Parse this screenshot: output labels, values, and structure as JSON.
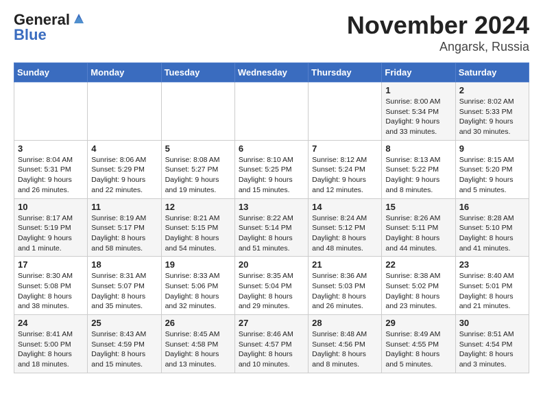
{
  "header": {
    "logo_line1": "General",
    "logo_line2": "Blue",
    "title": "November 2024",
    "subtitle": "Angarsk, Russia"
  },
  "weekdays": [
    "Sunday",
    "Monday",
    "Tuesday",
    "Wednesday",
    "Thursday",
    "Friday",
    "Saturday"
  ],
  "weeks": [
    [
      {
        "day": "",
        "info": ""
      },
      {
        "day": "",
        "info": ""
      },
      {
        "day": "",
        "info": ""
      },
      {
        "day": "",
        "info": ""
      },
      {
        "day": "",
        "info": ""
      },
      {
        "day": "1",
        "info": "Sunrise: 8:00 AM\nSunset: 5:34 PM\nDaylight: 9 hours and 33 minutes."
      },
      {
        "day": "2",
        "info": "Sunrise: 8:02 AM\nSunset: 5:33 PM\nDaylight: 9 hours and 30 minutes."
      }
    ],
    [
      {
        "day": "3",
        "info": "Sunrise: 8:04 AM\nSunset: 5:31 PM\nDaylight: 9 hours and 26 minutes."
      },
      {
        "day": "4",
        "info": "Sunrise: 8:06 AM\nSunset: 5:29 PM\nDaylight: 9 hours and 22 minutes."
      },
      {
        "day": "5",
        "info": "Sunrise: 8:08 AM\nSunset: 5:27 PM\nDaylight: 9 hours and 19 minutes."
      },
      {
        "day": "6",
        "info": "Sunrise: 8:10 AM\nSunset: 5:25 PM\nDaylight: 9 hours and 15 minutes."
      },
      {
        "day": "7",
        "info": "Sunrise: 8:12 AM\nSunset: 5:24 PM\nDaylight: 9 hours and 12 minutes."
      },
      {
        "day": "8",
        "info": "Sunrise: 8:13 AM\nSunset: 5:22 PM\nDaylight: 9 hours and 8 minutes."
      },
      {
        "day": "9",
        "info": "Sunrise: 8:15 AM\nSunset: 5:20 PM\nDaylight: 9 hours and 5 minutes."
      }
    ],
    [
      {
        "day": "10",
        "info": "Sunrise: 8:17 AM\nSunset: 5:19 PM\nDaylight: 9 hours and 1 minute."
      },
      {
        "day": "11",
        "info": "Sunrise: 8:19 AM\nSunset: 5:17 PM\nDaylight: 8 hours and 58 minutes."
      },
      {
        "day": "12",
        "info": "Sunrise: 8:21 AM\nSunset: 5:15 PM\nDaylight: 8 hours and 54 minutes."
      },
      {
        "day": "13",
        "info": "Sunrise: 8:22 AM\nSunset: 5:14 PM\nDaylight: 8 hours and 51 minutes."
      },
      {
        "day": "14",
        "info": "Sunrise: 8:24 AM\nSunset: 5:12 PM\nDaylight: 8 hours and 48 minutes."
      },
      {
        "day": "15",
        "info": "Sunrise: 8:26 AM\nSunset: 5:11 PM\nDaylight: 8 hours and 44 minutes."
      },
      {
        "day": "16",
        "info": "Sunrise: 8:28 AM\nSunset: 5:10 PM\nDaylight: 8 hours and 41 minutes."
      }
    ],
    [
      {
        "day": "17",
        "info": "Sunrise: 8:30 AM\nSunset: 5:08 PM\nDaylight: 8 hours and 38 minutes."
      },
      {
        "day": "18",
        "info": "Sunrise: 8:31 AM\nSunset: 5:07 PM\nDaylight: 8 hours and 35 minutes."
      },
      {
        "day": "19",
        "info": "Sunrise: 8:33 AM\nSunset: 5:06 PM\nDaylight: 8 hours and 32 minutes."
      },
      {
        "day": "20",
        "info": "Sunrise: 8:35 AM\nSunset: 5:04 PM\nDaylight: 8 hours and 29 minutes."
      },
      {
        "day": "21",
        "info": "Sunrise: 8:36 AM\nSunset: 5:03 PM\nDaylight: 8 hours and 26 minutes."
      },
      {
        "day": "22",
        "info": "Sunrise: 8:38 AM\nSunset: 5:02 PM\nDaylight: 8 hours and 23 minutes."
      },
      {
        "day": "23",
        "info": "Sunrise: 8:40 AM\nSunset: 5:01 PM\nDaylight: 8 hours and 21 minutes."
      }
    ],
    [
      {
        "day": "24",
        "info": "Sunrise: 8:41 AM\nSunset: 5:00 PM\nDaylight: 8 hours and 18 minutes."
      },
      {
        "day": "25",
        "info": "Sunrise: 8:43 AM\nSunset: 4:59 PM\nDaylight: 8 hours and 15 minutes."
      },
      {
        "day": "26",
        "info": "Sunrise: 8:45 AM\nSunset: 4:58 PM\nDaylight: 8 hours and 13 minutes."
      },
      {
        "day": "27",
        "info": "Sunrise: 8:46 AM\nSunset: 4:57 PM\nDaylight: 8 hours and 10 minutes."
      },
      {
        "day": "28",
        "info": "Sunrise: 8:48 AM\nSunset: 4:56 PM\nDaylight: 8 hours and 8 minutes."
      },
      {
        "day": "29",
        "info": "Sunrise: 8:49 AM\nSunset: 4:55 PM\nDaylight: 8 hours and 5 minutes."
      },
      {
        "day": "30",
        "info": "Sunrise: 8:51 AM\nSunset: 4:54 PM\nDaylight: 8 hours and 3 minutes."
      }
    ]
  ]
}
